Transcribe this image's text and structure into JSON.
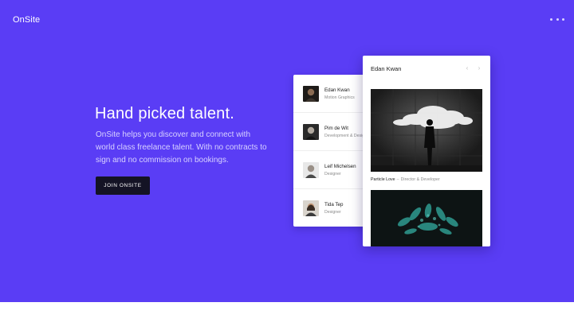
{
  "brand": {
    "name": "OnSite"
  },
  "colors": {
    "hero_bg": "#5a3df5",
    "button_bg": "#141325"
  },
  "hero": {
    "headline": "Hand picked talent.",
    "description": "OnSite helps you discover and connect with world class freelance talent. With no contracts to sign and no commission on bookings.",
    "cta_label": "JOIN ONSITE"
  },
  "talent_list": [
    {
      "name": "Edan Kwan",
      "role": "Motion Graphics"
    },
    {
      "name": "Pim de Wit",
      "role": "Development & Design"
    },
    {
      "name": "Leif Michelsen",
      "role": "Designer"
    },
    {
      "name": "Tida Tep",
      "role": "Designer"
    }
  ],
  "detail": {
    "name": "Edan Kwan",
    "prev_icon": "chevron-left-icon",
    "next_icon": "chevron-right-icon",
    "project": {
      "title": "Particle Love",
      "separator": "–",
      "role": "Director & Developer"
    }
  }
}
